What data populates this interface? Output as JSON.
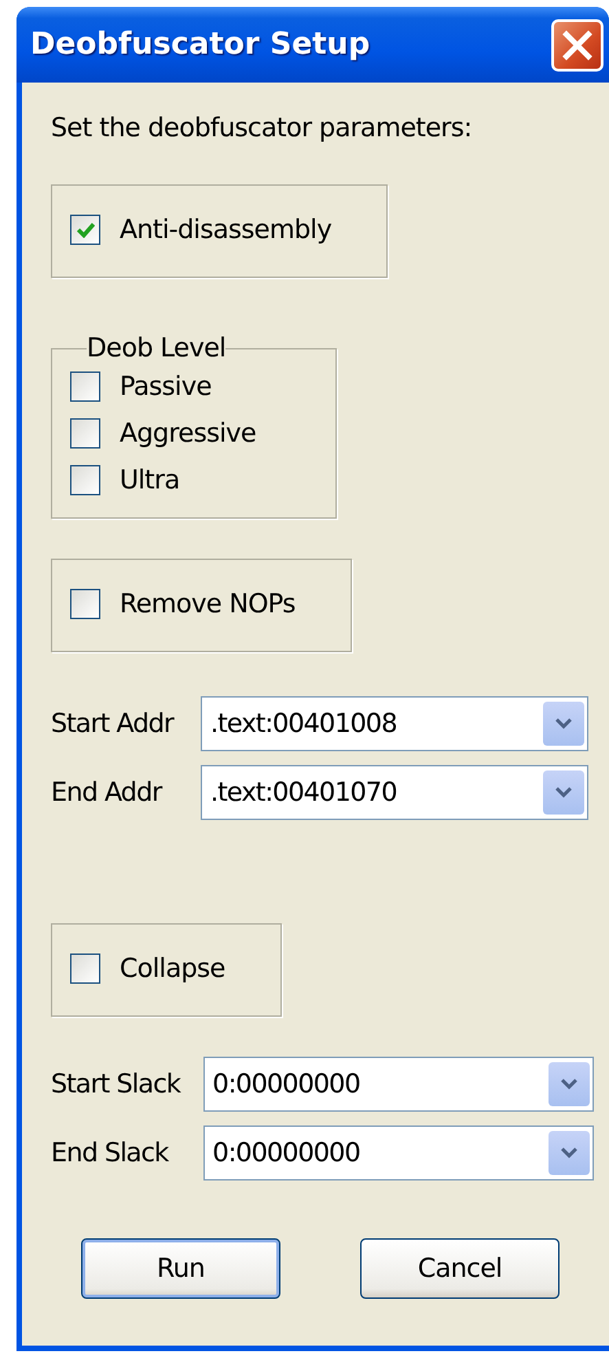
{
  "window": {
    "title": "Deobfuscator Setup"
  },
  "instruction": "Set the deobfuscator parameters:",
  "sections": [
    {
      "kind": "checkbox_box",
      "items": [
        {
          "label": "Anti-disassembly",
          "checked": true
        }
      ]
    },
    {
      "kind": "group",
      "title": "Deob Level",
      "items": [
        {
          "label": "Passive",
          "checked": false
        },
        {
          "label": "Aggressive",
          "checked": false
        },
        {
          "label": "Ultra",
          "checked": false
        }
      ]
    },
    {
      "kind": "checkbox_box",
      "items": [
        {
          "label": "Remove NOPs",
          "checked": false
        }
      ]
    },
    {
      "kind": "combos",
      "items": [
        {
          "label": "Start Addr",
          "value": ".text:00401008"
        },
        {
          "label": "End Addr",
          "value": ".text:00401070"
        }
      ]
    },
    {
      "kind": "checkbox_box",
      "items": [
        {
          "label": "Collapse",
          "checked": false
        }
      ]
    },
    {
      "kind": "combos",
      "items": [
        {
          "label": "Start Slack",
          "value": "0:00000000"
        },
        {
          "label": "End Slack",
          "value": "0:00000000"
        }
      ]
    }
  ],
  "buttons": [
    {
      "label": "Run",
      "default": true
    },
    {
      "label": "Cancel",
      "default": false
    }
  ]
}
